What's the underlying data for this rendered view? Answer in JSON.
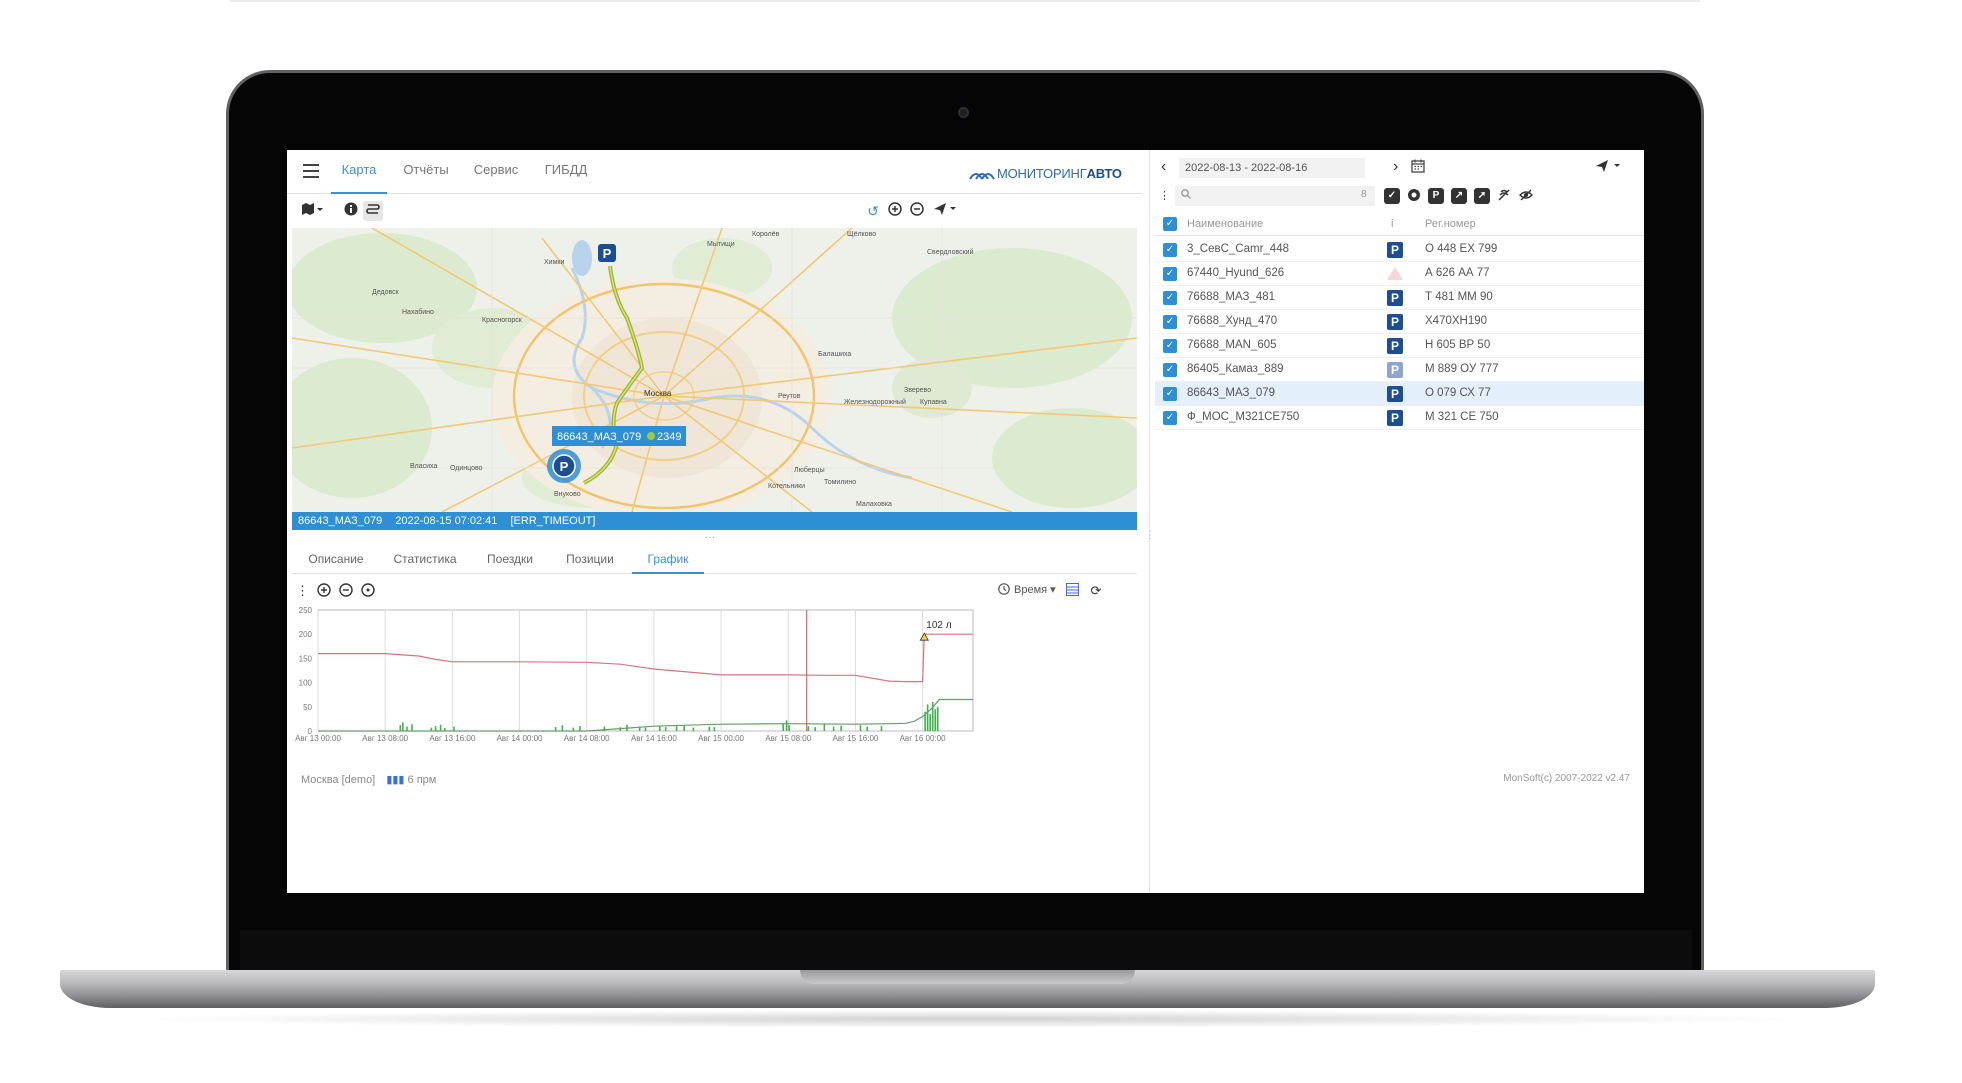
{
  "top_nav": {
    "tabs": [
      {
        "label": "Карта",
        "active": true
      },
      {
        "label": "Отчёты",
        "active": false
      },
      {
        "label": "Сервис",
        "active": false
      },
      {
        "label": "ГИБДД",
        "active": false
      }
    ],
    "logo_text_a": "МОНИТОРИНГ",
    "logo_text_b": "АВТО"
  },
  "map": {
    "labels": [
      "Королёв",
      "Щёлково",
      "Химки",
      "Мытищи",
      "Свердловский",
      "Дедовск",
      "Нахабино",
      "Красногорск",
      "Балашиха",
      "Москва",
      "Реутов",
      "Железнодорожный",
      "Купавна",
      "Зверево",
      "Одинцово",
      "Внуково",
      "Люберцы",
      "Томилино",
      "Котельники",
      "Малаховка",
      "Власиха"
    ],
    "vehicle_label": "86643_МАЗ_079",
    "vehicle_value": "2349",
    "parking_icon": "parking-marker-icon"
  },
  "status_bar": {
    "vehicle": "86643_МАЗ_079",
    "datetime": "2022-08-15 07:02:41",
    "error": "[ERR_TIMEOUT]"
  },
  "detail_tabs": [
    {
      "label": "Описание",
      "active": false
    },
    {
      "label": "Статистика",
      "active": false
    },
    {
      "label": "Поездки",
      "active": false
    },
    {
      "label": "Позиции",
      "active": false
    },
    {
      "label": "График",
      "active": true
    }
  ],
  "chart_tools": {
    "time_label": "Время"
  },
  "chart_data": {
    "type": "line",
    "ylim": [
      0,
      250
    ],
    "yticks": [
      "0",
      "50",
      "100",
      "150",
      "200",
      "250"
    ],
    "xticks": [
      "Авг 13 00:00",
      "Авг 13 08:00",
      "Авг 13 16:00",
      "Авг 14 00:00",
      "Авг 14 08:00",
      "Авг 14 16:00",
      "Авг 15 00:00",
      "Авг 15 08:00",
      "Авг 15 16:00",
      "Авг 16 00:00"
    ],
    "annotation": "102 л",
    "series": [
      {
        "color": "#d9737b",
        "x": [
          0,
          8,
          12,
          14,
          16,
          24,
          32,
          36,
          40,
          48,
          56,
          60,
          64,
          68,
          70,
          72,
          72.2,
          74,
          78
        ],
        "y": [
          160,
          160,
          155,
          148,
          143,
          143,
          142,
          138,
          128,
          116,
          116,
          115,
          115,
          103,
          102,
          102,
          200,
          200,
          200
        ]
      },
      {
        "color": "#6a9a6a",
        "x": [
          0,
          16,
          32,
          40,
          48,
          56,
          64,
          68,
          70,
          71,
          72,
          73,
          74,
          78
        ],
        "y": [
          0,
          0,
          0,
          10,
          14,
          15,
          14,
          15,
          16,
          20,
          30,
          45,
          65,
          65
        ]
      },
      {
        "color": "#39b54a",
        "type": "bars",
        "x": [
          9.8,
          10.1,
          10.6,
          11.2,
          13.5,
          14.0,
          14.6,
          15.1,
          16.2,
          28.3,
          29.1,
          30.4,
          31.2,
          34.1,
          36.0,
          36.8,
          38.3,
          39.0,
          40.7,
          41.4,
          42.7,
          43.6,
          44.7,
          46.6,
          47.2,
          55.4,
          55.8,
          56.1,
          58.4,
          59.2,
          60.3,
          61.4,
          62.3,
          64.6,
          65.4,
          67.1,
          72.3,
          72.6,
          72.9,
          73.2,
          73.5,
          73.8
        ],
        "y": [
          12,
          18,
          9,
          14,
          7,
          10,
          13,
          6,
          9,
          8,
          12,
          7,
          10,
          9,
          8,
          13,
          9,
          7,
          11,
          8,
          10,
          12,
          7,
          9,
          8,
          15,
          22,
          12,
          10,
          8,
          14,
          9,
          11,
          12,
          9,
          10,
          40,
          55,
          35,
          60,
          45,
          50
        ]
      }
    ],
    "marker_x": 58.2
  },
  "footer_left": {
    "region": "Москва [demo]",
    "signal": "6 прм"
  },
  "date_range": "2022-08-13 - 2022-08-16",
  "search": {
    "placeholder": "",
    "count": "8"
  },
  "vehicle_list": {
    "headers": {
      "name": "Наименование",
      "info": "i",
      "reg": "Рег.номер"
    },
    "rows": [
      {
        "name": "3_СевС_Camr_448",
        "reg": "О 448 ЕХ 799",
        "status": "parking",
        "selected": false
      },
      {
        "name": "67440_Hyund_626",
        "reg": "А 626 АА 77",
        "status": "alert",
        "selected": false
      },
      {
        "name": "76688_МАЗ_481",
        "reg": "Т 481 ММ 90",
        "status": "parking",
        "selected": false
      },
      {
        "name": "76688_Хунд_470",
        "reg": "Х470ХН190",
        "status": "parking",
        "selected": false
      },
      {
        "name": "76688_MAN_605",
        "reg": "Н 605 ВР 50",
        "status": "parking",
        "selected": false
      },
      {
        "name": "86405_Камаз_889",
        "reg": "М 889 ОУ 777",
        "status": "parking-light",
        "selected": false
      },
      {
        "name": "86643_МАЗ_079",
        "reg": "О 079 СХ 77",
        "status": "parking",
        "selected": true
      },
      {
        "name": "Ф_МОС_М321СЕ750",
        "reg": "М 321 СЕ 750",
        "status": "parking",
        "selected": false
      }
    ]
  },
  "footer_right": "MonSoft(c) 2007-2022 v2.47",
  "colors": {
    "accent": "#3a8fd8",
    "status_bar": "#2f8fd4",
    "parking_badge": "#1d4e95",
    "selected_row": "#e3f0fb"
  }
}
